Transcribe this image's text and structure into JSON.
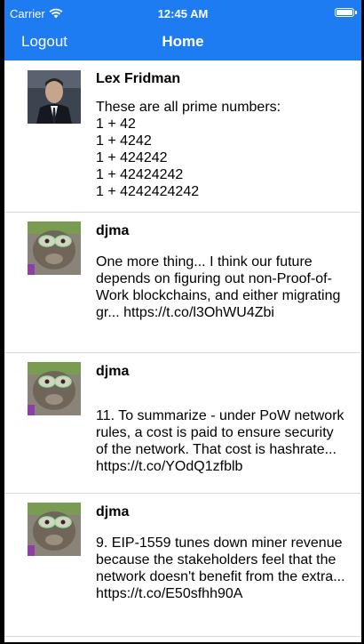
{
  "status_bar": {
    "carrier": "Carrier",
    "time": "12:45 AM"
  },
  "nav": {
    "left_label": "Logout",
    "title": "Home"
  },
  "tweets": [
    {
      "author": "Lex Fridman",
      "text": "These are all prime numbers:\n1 + 42\n1 + 4242\n1 + 424242\n1 + 42424242\n1 + 4242424242"
    },
    {
      "author": "djma",
      "text": "One more thing... I think our future depends on figuring out non-Proof-of-Work blockchains, and either migrating gr... https://t.co/l3OhWU4Zbi"
    },
    {
      "author": "djma",
      "text": "11. To summarize - under PoW network rules, a cost is paid to ensure security of the network. That cost is hashrate... https://t.co/YOdQ1zfblb"
    },
    {
      "author": "djma",
      "text": "9. EIP-1559 tunes down miner revenue because the stakeholders feel that the network doesn't benefit from the extra... https://t.co/E50sfhh90A"
    }
  ]
}
